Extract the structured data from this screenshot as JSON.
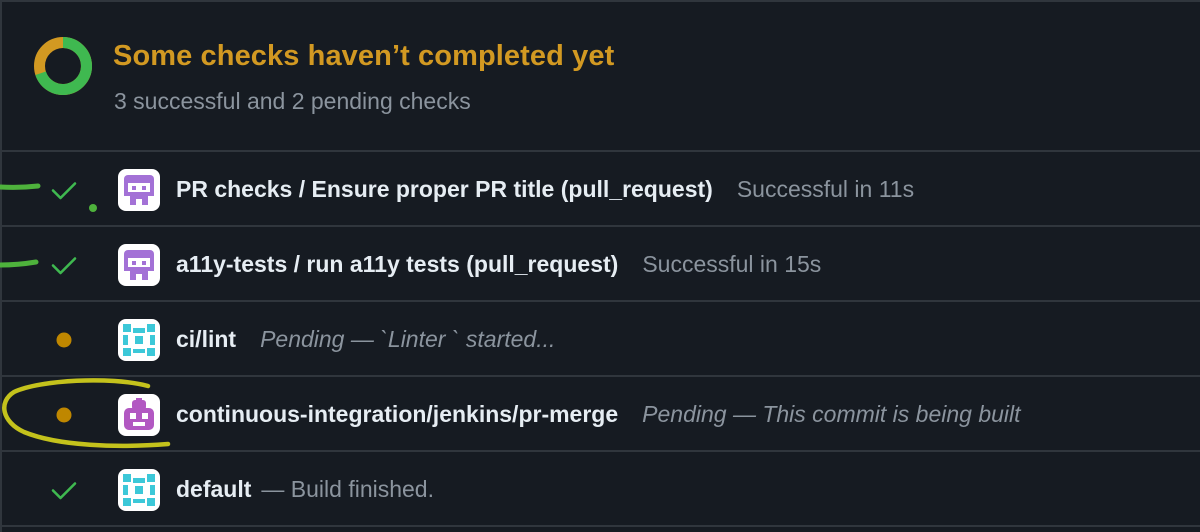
{
  "header": {
    "title": "Some checks haven’t completed yet",
    "summary": "3 successful and 2 pending checks",
    "donut": {
      "successful": 3,
      "pending": 2,
      "success_color": "#3fb950",
      "pending_color": "#d29922"
    }
  },
  "checks": [
    {
      "status": "success",
      "avatar": "purple-bot-icon",
      "name": "PR checks / Ensure proper PR title (pull_request)",
      "description": "Successful in 11s"
    },
    {
      "status": "success",
      "avatar": "purple-bot-icon",
      "name": "a11y-tests / run a11y tests (pull_request)",
      "description": "Successful in 15s"
    },
    {
      "status": "pending",
      "avatar": "cyan-bot-icon",
      "name": "ci/lint",
      "description": "Pending — `Linter ` started..."
    },
    {
      "status": "pending",
      "avatar": "jenkins-bot-icon",
      "name": "continuous-integration/jenkins/pr-merge",
      "description": "Pending — This commit is being built"
    },
    {
      "status": "success",
      "avatar": "cyan-bot-icon",
      "name": "default",
      "description": "— Build finished."
    }
  ],
  "colors": {
    "background": "#161b22",
    "border": "#30363d",
    "success": "#3fb950",
    "pending": "#bf8700",
    "muted": "#8b949e",
    "annotation_green": "#4eb23c",
    "annotation_yellow": "#c4c21c"
  }
}
